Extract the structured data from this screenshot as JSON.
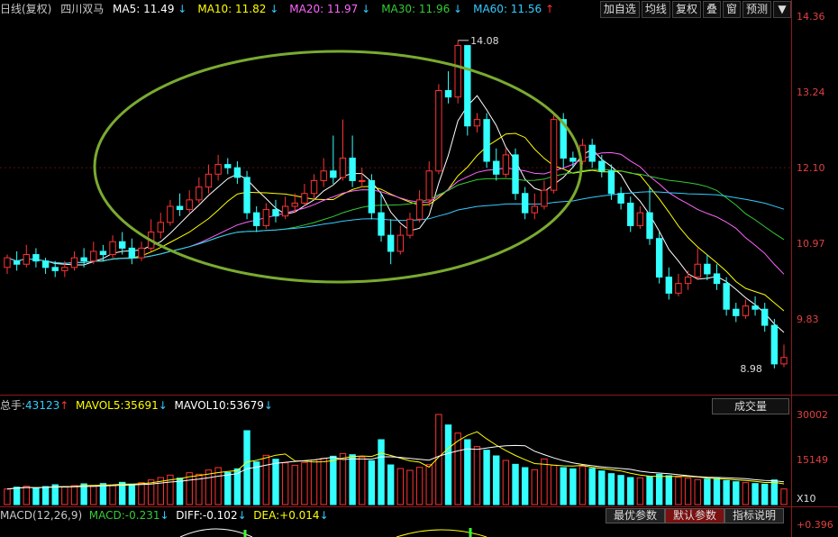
{
  "header": {
    "period": "日线(复权)",
    "stock": "四川双马",
    "ma": [
      {
        "name": "MA5",
        "value": "11.49",
        "arrow": "↓",
        "color": "#ffffff"
      },
      {
        "name": "MA10",
        "value": "11.82",
        "arrow": "↓",
        "color": "#ffff00"
      },
      {
        "name": "MA20",
        "value": "11.97",
        "arrow": "↓",
        "color": "#ff66ff"
      },
      {
        "name": "MA30",
        "value": "11.96",
        "arrow": "↓",
        "color": "#33cc33"
      },
      {
        "name": "MA60",
        "value": "11.56",
        "arrow": "↑",
        "color": "#33ccff"
      }
    ]
  },
  "toolbar": [
    "加自选",
    "均线",
    "复权",
    "叠",
    "窗",
    "预测"
  ],
  "price_axis": [
    "14.36",
    "13.24",
    "12.10",
    "10.97",
    "9.83"
  ],
  "annotations": {
    "high": "14.08",
    "low": "8.98"
  },
  "volume": {
    "total_label": "总手:",
    "total": "43123",
    "total_arrow": "↑",
    "mavol5_label": "MAVOL5:",
    "mavol5": "35691",
    "mavol5_arrow": "↓",
    "mavol10_label": "MAVOL10:",
    "mavol10": "53679",
    "mavol10_arrow": "↓",
    "selector": "成交量",
    "axis": [
      "30002",
      "15149",
      "X10"
    ]
  },
  "macd": {
    "label": "MACD(12,26,9)",
    "macd_label": "MACD:",
    "macd": "-0.231",
    "macd_arrow": "↓",
    "diff_label": "DIFF:",
    "diff": "-0.102",
    "diff_arrow": "↓",
    "dea_label": "DEA:",
    "dea": "+0.014",
    "dea_arrow": "↓",
    "axis": "+0.396",
    "tabs": [
      "最优参数",
      "默认参数",
      "指标说明"
    ]
  },
  "colors": {
    "up": "#ff3333",
    "down": "#33ffff",
    "axis": "#e04040"
  },
  "chart_data": {
    "type": "candlestick",
    "ylim": [
      8.6,
      14.4
    ],
    "candles": [
      [
        10.55,
        10.7,
        10.45,
        10.75
      ],
      [
        10.65,
        10.6,
        10.5,
        10.8
      ],
      [
        10.6,
        10.75,
        10.55,
        10.9
      ],
      [
        10.75,
        10.65,
        10.55,
        10.85
      ],
      [
        10.65,
        10.55,
        10.45,
        10.7
      ],
      [
        10.55,
        10.5,
        10.4,
        10.65
      ],
      [
        10.5,
        10.55,
        10.4,
        10.65
      ],
      [
        10.55,
        10.7,
        10.5,
        10.8
      ],
      [
        10.7,
        10.65,
        10.55,
        10.85
      ],
      [
        10.65,
        10.8,
        10.6,
        10.95
      ],
      [
        10.8,
        10.75,
        10.65,
        10.9
      ],
      [
        10.75,
        10.95,
        10.7,
        11.05
      ],
      [
        10.95,
        10.85,
        10.75,
        11.1
      ],
      [
        10.85,
        10.7,
        10.6,
        11.0
      ],
      [
        10.7,
        10.85,
        10.65,
        10.95
      ],
      [
        10.85,
        11.1,
        10.8,
        11.3
      ],
      [
        11.1,
        11.25,
        11.0,
        11.4
      ],
      [
        11.25,
        11.5,
        11.2,
        11.6
      ],
      [
        11.5,
        11.45,
        11.35,
        11.7
      ],
      [
        11.45,
        11.6,
        11.4,
        11.75
      ],
      [
        11.6,
        11.8,
        11.55,
        11.95
      ],
      [
        11.8,
        12.0,
        11.7,
        12.15
      ],
      [
        12.0,
        12.15,
        11.9,
        12.3
      ],
      [
        12.15,
        12.1,
        12.0,
        12.25
      ],
      [
        12.1,
        11.95,
        11.85,
        12.2
      ],
      [
        11.95,
        11.4,
        11.3,
        12.05
      ],
      [
        11.4,
        11.2,
        11.1,
        11.5
      ],
      [
        11.2,
        11.45,
        11.15,
        11.55
      ],
      [
        11.45,
        11.35,
        11.25,
        11.6
      ],
      [
        11.35,
        11.5,
        11.3,
        11.65
      ],
      [
        11.5,
        11.55,
        11.4,
        11.7
      ],
      [
        11.55,
        11.7,
        11.5,
        11.85
      ],
      [
        11.7,
        11.9,
        11.6,
        12.0
      ],
      [
        11.9,
        12.05,
        11.8,
        12.25
      ],
      [
        12.05,
        11.95,
        11.85,
        12.6
      ],
      [
        11.95,
        12.25,
        11.9,
        12.85
      ],
      [
        12.25,
        11.9,
        11.8,
        12.6
      ],
      [
        11.9,
        11.9,
        11.8,
        12.1
      ],
      [
        11.9,
        11.4,
        11.3,
        12.0
      ],
      [
        11.4,
        11.05,
        10.95,
        11.7
      ],
      [
        11.05,
        10.8,
        10.6,
        11.3
      ],
      [
        10.8,
        11.05,
        10.75,
        11.2
      ],
      [
        11.05,
        11.3,
        11.0,
        11.4
      ],
      [
        11.3,
        11.6,
        11.25,
        11.75
      ],
      [
        11.6,
        12.05,
        11.5,
        12.2
      ],
      [
        12.05,
        13.3,
        12.0,
        13.4
      ],
      [
        13.3,
        13.2,
        13.1,
        13.6
      ],
      [
        13.2,
        14.0,
        13.1,
        14.08
      ],
      [
        14.0,
        12.75,
        12.6,
        14.0
      ],
      [
        12.75,
        12.85,
        12.65,
        12.95
      ],
      [
        12.85,
        12.2,
        12.1,
        12.95
      ],
      [
        12.2,
        12.0,
        11.9,
        12.4
      ],
      [
        12.0,
        12.3,
        11.95,
        12.4
      ],
      [
        12.3,
        11.7,
        11.6,
        12.4
      ],
      [
        11.7,
        11.4,
        11.3,
        11.8
      ],
      [
        11.4,
        11.5,
        11.3,
        11.7
      ],
      [
        11.5,
        11.75,
        11.45,
        11.9
      ],
      [
        11.75,
        12.85,
        11.7,
        12.95
      ],
      [
        12.85,
        12.25,
        12.1,
        12.95
      ],
      [
        12.25,
        12.2,
        12.1,
        12.35
      ],
      [
        12.2,
        12.45,
        12.15,
        12.55
      ],
      [
        12.45,
        12.2,
        12.1,
        12.55
      ],
      [
        12.2,
        12.05,
        11.95,
        12.3
      ],
      [
        12.05,
        11.7,
        11.6,
        12.15
      ],
      [
        11.7,
        11.55,
        11.45,
        11.8
      ],
      [
        11.55,
        11.2,
        11.1,
        11.65
      ],
      [
        11.2,
        11.4,
        11.15,
        11.5
      ],
      [
        11.4,
        11.0,
        10.9,
        11.8
      ],
      [
        11.0,
        10.4,
        10.3,
        11.1
      ],
      [
        10.4,
        10.15,
        10.05,
        10.55
      ],
      [
        10.15,
        10.3,
        10.1,
        10.45
      ],
      [
        10.3,
        10.4,
        10.2,
        10.5
      ],
      [
        10.4,
        10.6,
        10.35,
        10.85
      ],
      [
        10.6,
        10.45,
        10.35,
        10.75
      ],
      [
        10.45,
        10.3,
        10.2,
        10.6
      ],
      [
        10.3,
        9.9,
        9.8,
        10.4
      ],
      [
        9.9,
        9.8,
        9.7,
        10.0
      ],
      [
        9.8,
        9.95,
        9.75,
        10.05
      ],
      [
        9.95,
        9.9,
        9.8,
        10.1
      ],
      [
        9.9,
        9.65,
        9.55,
        10.0
      ],
      [
        9.65,
        9.05,
        8.98,
        9.75
      ],
      [
        9.05,
        9.15,
        9.0,
        9.35
      ]
    ],
    "volume": [
      5200,
      5800,
      6100,
      5400,
      6000,
      6600,
      5900,
      6300,
      6900,
      6200,
      7000,
      6500,
      7400,
      6800,
      7300,
      8200,
      9000,
      9800,
      8800,
      10600,
      10100,
      11500,
      12300,
      10700,
      11900,
      24600,
      14200,
      16400,
      15100,
      13900,
      13100,
      14000,
      14800,
      15400,
      16100,
      17000,
      16600,
      15800,
      14600,
      21600,
      13200,
      12000,
      11400,
      12400,
      13300,
      30002,
      26500,
      23800,
      21600,
      19300,
      18100,
      16200,
      14700,
      13400,
      12300,
      11600,
      15200,
      13100,
      12300,
      11900,
      12700,
      12000,
      11200,
      10300,
      9700,
      9000,
      8900,
      9300,
      10100,
      9600,
      9100,
      8800,
      8300,
      8500,
      8700,
      8000,
      7600,
      7300,
      7000,
      6800,
      8200,
      5200
    ]
  }
}
